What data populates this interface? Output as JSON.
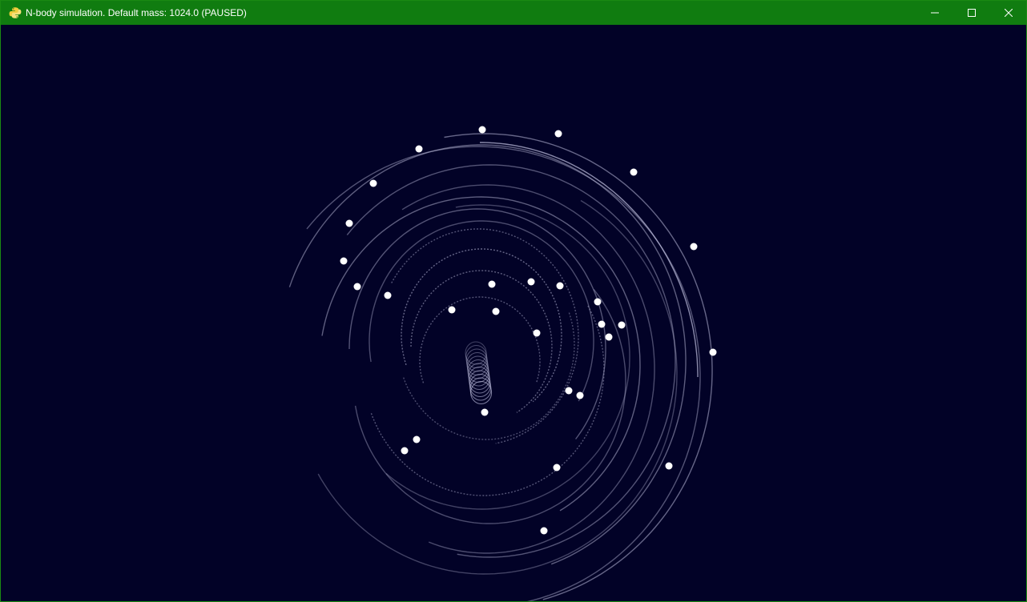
{
  "window": {
    "title": "N-body simulation. Default mass: 1024.0 (PAUSED)",
    "app_icon": "python-icon",
    "controls": [
      "minimize-icon",
      "maximize-icon",
      "close-icon"
    ]
  },
  "colors": {
    "titlebar": "#107c10",
    "background": "#020227",
    "body": "#ffffff",
    "trail": "#b9b9d8"
  },
  "simulation": {
    "state": "PAUSED",
    "default_mass": 1024.0
  }
}
